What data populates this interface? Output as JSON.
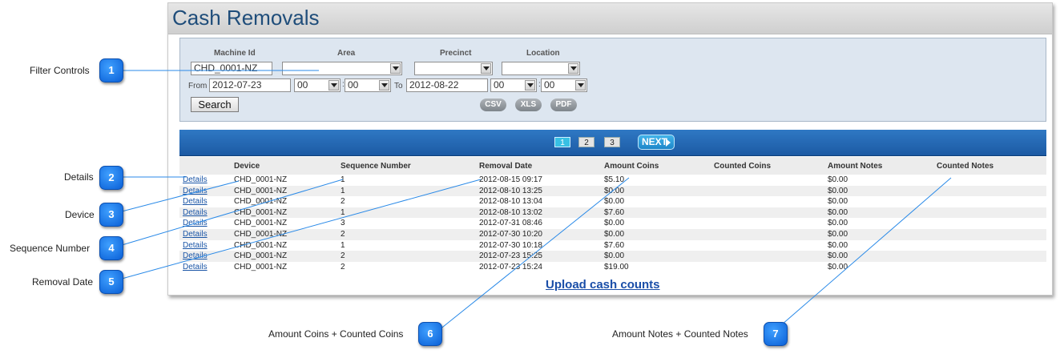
{
  "window": {
    "title": "Cash Removals"
  },
  "filters": {
    "machine_id_label": "Machine Id",
    "machine_id_value": "CHD_0001-NZ",
    "area_label": "Area",
    "precinct_label": "Precinct",
    "location_label": "Location",
    "from_label": "From",
    "from_date": "2012-07-23",
    "from_hour": "00",
    "from_min": "00",
    "to_label": "To",
    "to_date": "2012-08-22",
    "to_hour": "00",
    "to_min": "00",
    "search_label": "Search",
    "export": {
      "csv": "CSV",
      "xls": "XLS",
      "pdf": "PDF"
    }
  },
  "pager": {
    "pages": [
      "1",
      "2",
      "3"
    ],
    "active": "1",
    "next_label": "NEXT"
  },
  "table": {
    "headers": [
      "Device",
      "Sequence Number",
      "Removal Date",
      "Amount Coins",
      "Counted Coins",
      "Amount Notes",
      "Counted Notes"
    ],
    "details_label": "Details",
    "rows": [
      {
        "device": "CHD_0001-NZ",
        "sequence": "1",
        "date": "2012-08-15 09:17",
        "coins": "$5.10",
        "counted_coins": "",
        "notes": "$0.00",
        "counted_notes": ""
      },
      {
        "device": "CHD_0001-NZ",
        "sequence": "1",
        "date": "2012-08-10 13:25",
        "coins": "$0.00",
        "counted_coins": "",
        "notes": "$0.00",
        "counted_notes": ""
      },
      {
        "device": "CHD_0001-NZ",
        "sequence": "2",
        "date": "2012-08-10 13:04",
        "coins": "$0.00",
        "counted_coins": "",
        "notes": "$0.00",
        "counted_notes": ""
      },
      {
        "device": "CHD_0001-NZ",
        "sequence": "1",
        "date": "2012-08-10 13:02",
        "coins": "$7.60",
        "counted_coins": "",
        "notes": "$0.00",
        "counted_notes": ""
      },
      {
        "device": "CHD_0001-NZ",
        "sequence": "3",
        "date": "2012-07-31 08:46",
        "coins": "$0.00",
        "counted_coins": "",
        "notes": "$0.00",
        "counted_notes": ""
      },
      {
        "device": "CHD_0001-NZ",
        "sequence": "2",
        "date": "2012-07-30 10:20",
        "coins": "$0.00",
        "counted_coins": "",
        "notes": "$0.00",
        "counted_notes": ""
      },
      {
        "device": "CHD_0001-NZ",
        "sequence": "1",
        "date": "2012-07-30 10:18",
        "coins": "$7.60",
        "counted_coins": "",
        "notes": "$0.00",
        "counted_notes": ""
      },
      {
        "device": "CHD_0001-NZ",
        "sequence": "2",
        "date": "2012-07-23 15:25",
        "coins": "$0.00",
        "counted_coins": "",
        "notes": "$0.00",
        "counted_notes": ""
      },
      {
        "device": "CHD_0001-NZ",
        "sequence": "2",
        "date": "2012-07-23 15:24",
        "coins": "$19.00",
        "counted_coins": "",
        "notes": "$0.00",
        "counted_notes": ""
      }
    ]
  },
  "upload_link": "Upload cash counts",
  "callouts": [
    {
      "number": "1",
      "label": "Filter Controls"
    },
    {
      "number": "2",
      "label": "Details"
    },
    {
      "number": "3",
      "label": "Device"
    },
    {
      "number": "4",
      "label": "Sequence Number"
    },
    {
      "number": "5",
      "label": "Removal Date"
    },
    {
      "number": "6",
      "label": "Amount Coins + Counted Coins"
    },
    {
      "number": "7",
      "label": "Amount Notes + Counted Notes"
    }
  ],
  "colors": {
    "title": "#1f4d7a",
    "pager": "#2f78c4",
    "badge": "#0a5fd6",
    "link": "#1a55a6"
  }
}
